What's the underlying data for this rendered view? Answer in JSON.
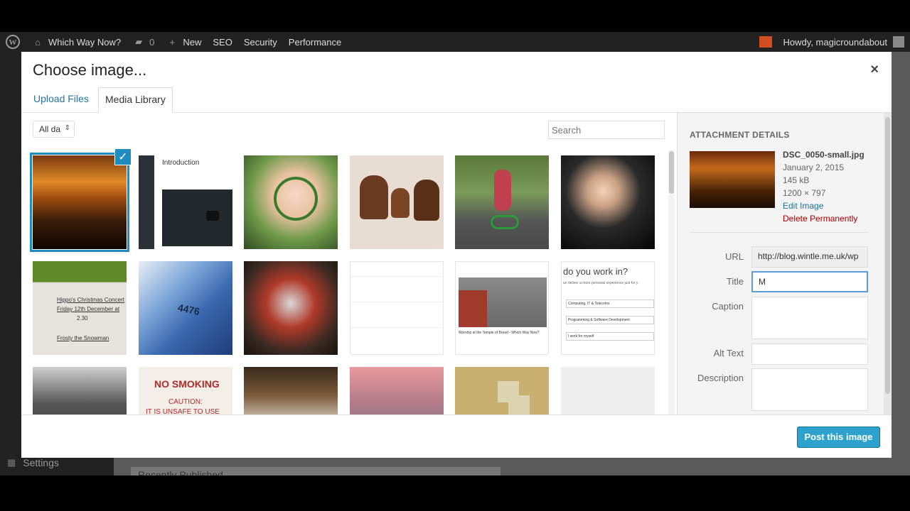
{
  "adminbar": {
    "site_name": "Which Way Now?",
    "comments_count": "0",
    "new_label": "New",
    "seo_label": "SEO",
    "security_label": "Security",
    "performance_label": "Performance",
    "howdy": "Howdy, magicroundabout"
  },
  "sidebar_behind": {
    "settings_label": "Settings"
  },
  "behind": {
    "recently_published": "Recently Published"
  },
  "modal": {
    "title": "Choose image...",
    "close_symbol": "×",
    "tabs": [
      {
        "label": "Upload Files"
      },
      {
        "label": "Media Library"
      }
    ],
    "filter": {
      "value": "All da"
    },
    "search": {
      "placeholder": "Search"
    },
    "thumbs": {
      "t2_title": "Introduction",
      "t10_header": "do you work in?",
      "t10_sub": "an deliver a more personal experience just for y",
      "t10_opt1": "Computing, IT & Telecoms",
      "t10_opt2": "Programming & Software Development",
      "t10_opt3": "I work for myself",
      "t9_caption": "Worship at the Temple of Bread - Which Way Now?",
      "t14_text": "NO SMOKING",
      "t14_sub": "CAUTION:",
      "t14_sub2": "IT IS UNSAFE TO USE",
      "t7_line1": "Hippo's Christmas Concert",
      "t7_line2": "Friday 12th December at",
      "t7_line3": "2.30",
      "t7_line4": "Frosty the Snowman",
      "t8_text": "4476"
    },
    "details": {
      "heading": "ATTACHMENT DETAILS",
      "filename": "DSC_0050-small.jpg",
      "date": "January 2, 2015",
      "size": "145 kB",
      "dimensions": "1200 × 797",
      "edit_link": "Edit Image",
      "delete_link": "Delete Permanently",
      "url_label": "URL",
      "url_value": "http://blog.wintle.me.uk/wp",
      "title_label": "Title",
      "title_value": "M",
      "caption_label": "Caption",
      "alt_label": "Alt Text",
      "description_label": "Description"
    },
    "post_button": "Post this image"
  },
  "colors": {
    "accent": "#2ea2cc",
    "link": "#21759b",
    "danger": "#a00000",
    "selection": "#1e8cbe"
  }
}
